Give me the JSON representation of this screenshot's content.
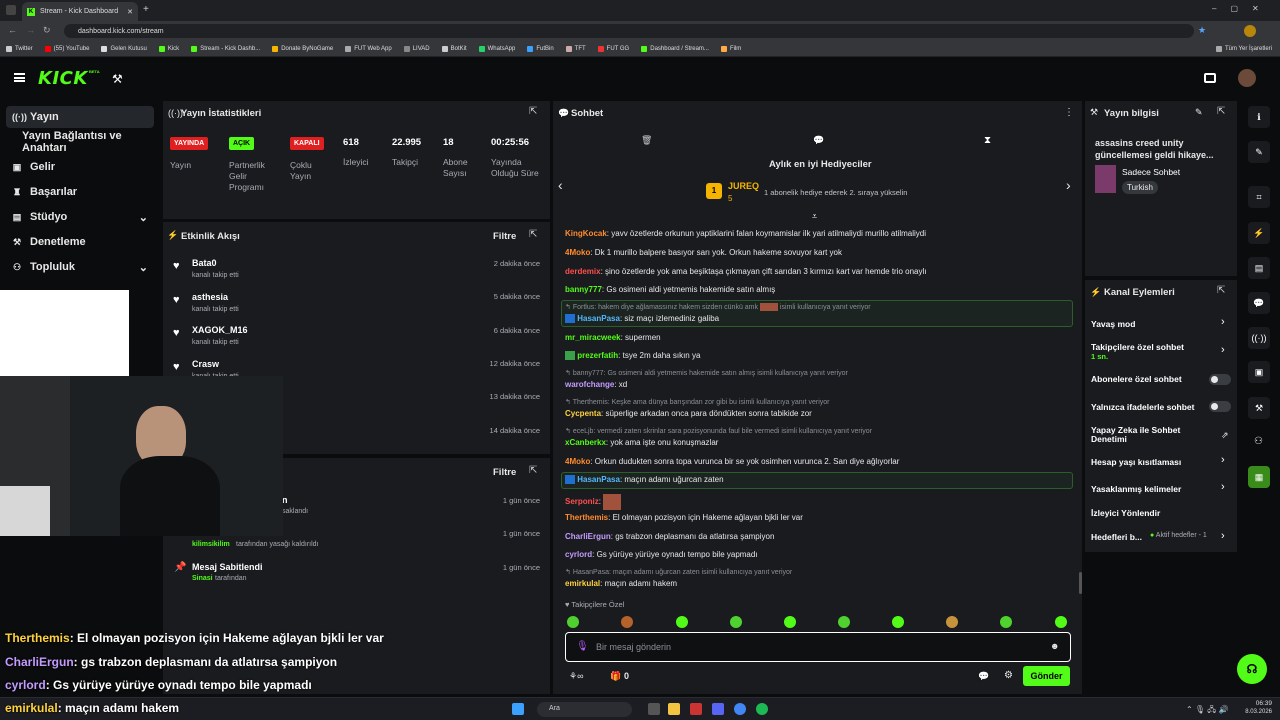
{
  "browser": {
    "tab_title": "Stream - Kick Dashboard",
    "url": "dashboard.kick.com/stream",
    "bookmarks": [
      "Twitter",
      "(55) YouTube",
      "Gelen Kutusu",
      "Kick",
      "Stream - Kick Dashb...",
      "Donate ByNoGame",
      "FUT Web App",
      "LIVAD",
      "BotKit",
      "WhatsApp",
      "FutBin",
      "TFT",
      "FUT GG",
      "Dashboard / Stream...",
      "Film"
    ],
    "bookmarks_all": "Tüm Yer İşaretleri"
  },
  "header": {
    "logo": "KICK",
    "beta": "BETA"
  },
  "nav": {
    "items": [
      "Yayın",
      "Yayın Bağlantısı ve Anahtarı",
      "Gelir",
      "Başarılar",
      "Stüdyo",
      "Denetleme",
      "Topluluk"
    ]
  },
  "stats": {
    "title": "Yayın İstatistikleri",
    "badges": [
      {
        "badge": "YAYINDA",
        "label": "Yayın",
        "color": "#e02020"
      },
      {
        "badge": "AÇIK",
        "label": "Partnerlik Gelir Programı",
        "color": "#53fc18"
      },
      {
        "badge": "KAPALI",
        "label": "Çoklu Yayın",
        "color": "#e02020"
      }
    ],
    "values": [
      {
        "value": "618",
        "label": "İzleyici"
      },
      {
        "value": "22.995",
        "label": "Takipçi"
      },
      {
        "value": "18",
        "label": "Abone Sayısı"
      },
      {
        "value": "00:25:56",
        "label": "Yayında Olduğu Süre"
      }
    ]
  },
  "activity": {
    "title": "Etkinlik Akışı",
    "filter": "Filtre",
    "items": [
      {
        "name": "Bata0",
        "sub": "kanalı takip etti",
        "time": "2 dakika önce"
      },
      {
        "name": "asthesia",
        "sub": "kanalı takip etti",
        "time": "5 dakika önce"
      },
      {
        "name": "XAGOK_M16",
        "sub": "kanalı takip etti",
        "time": "6 dakika önce"
      },
      {
        "name": "Crasw",
        "sub": "kanalı takip etti",
        "time": "12 dakika önce"
      },
      {
        "name": "",
        "sub": "",
        "time": "13 dakika önce"
      },
      {
        "name": "",
        "sub": "",
        "time": "14 dakika önce"
      }
    ]
  },
  "modlog": {
    "filter": "Filtre",
    "items": [
      {
        "name": "n",
        "sub": "saklandı",
        "time": "1 gün önce"
      },
      {
        "name": "",
        "sub_user": "kilimsikilim",
        "sub": "tarafından yasağı kaldırıldı",
        "time": "1 gün önce"
      },
      {
        "name": "Mesaj Sabitlendi",
        "sub_user": "Sinasi",
        "sub": "tarafından",
        "time": "1 gün önce"
      }
    ]
  },
  "chat": {
    "title": "Sohbet",
    "top_gifters": "Aylık en iyi Hediyeciler",
    "gifter_name": "JUREQ",
    "gifter_count": "5",
    "gifter_note": "1 abonelik hediye ederek 2. sıraya yükselin",
    "messages": [
      {
        "user": "KingKocak",
        "color": "#ff8c2e",
        "text": "yavv özetlerde orkunun yaptiklarini falan koymamislar ilk yari atilmaliydi murillo atilmaliydi"
      },
      {
        "user": "4Moko",
        "color": "#ff8c2e",
        "text": "Dk 1 murillo balpere basıyor sarı yok. Orkun hakeme sovuyor kart yok"
      },
      {
        "user": "derdemix",
        "color": "#ff4f4f",
        "text": "şino özetlerde yok ama beşiktaşa çıkmayan çift sarıdan 3 kırmızı kart var hemde trio onaylı"
      },
      {
        "user": "banny777",
        "color": "#53fc18",
        "text": "Gs osimeni aldi yetmemis hakemide satın almış"
      },
      {
        "reply": "Fortlus: hakem diye ağlamassınız hakem sizden cünkü amk",
        "reply_tail": "isimli kullanıcıya yanıt veriyor",
        "user": "HasanPasa",
        "color": "#55b8ff",
        "text": "siz maçı izlemediniz galiba"
      },
      {
        "user": "mr_miracweek",
        "color": "#53fc18",
        "text": "supermen"
      },
      {
        "user": "prezerfatih",
        "color": "#53fc18",
        "text": "tsye 2m daha sıkın ya"
      },
      {
        "reply": "banny777: Gs osimeni aldi yetmemis hakemide satın almış isimli kullanıcıya yanıt veriyor",
        "user": "warofchange",
        "color": "#c49cff",
        "text": "xd"
      },
      {
        "reply": "Therthemis: Keşke ama dünya barışından zor gibi bu isimli kullanıcıya yanıt veriyor",
        "user": "Cycpenta",
        "color": "#ffd23f",
        "text": "süperlige arkadan onca para döndükten sonra tabikide zor"
      },
      {
        "reply": "eceLjb: vermedi zaten skrinlar sara pozisyonunda faul bile vermedi isimli kullanıcıya yanıt veriyor",
        "user": "xCanberkx",
        "color": "#53fc18",
        "text": "yok ama işte onu konuşmazlar"
      },
      {
        "user": "4Moko",
        "color": "#ff8c2e",
        "text": "Orkun dudukten sonra topa vurunca bir se yok osimhen vurunca 2. San diye ağlıyorlar"
      },
      {
        "user": "HasanPasa",
        "color": "#55b8ff",
        "text": "maçın adamı uğurcan zaten"
      },
      {
        "user": "Serponiz",
        "color": "#ff4f4f",
        "text": ""
      },
      {
        "user": "Therthemis",
        "color": "#ff8c2e",
        "text": "El olmayan pozisyon için Hakeme ağlayan bjkli ler var"
      },
      {
        "user": "CharliErgun",
        "color": "#c49cff",
        "text": "gs trabzon deplasmanı da atlatırsa şampiyon"
      },
      {
        "user": "cyrlord",
        "color": "#c49cff",
        "text": "Gs yürüye yürüye oynadı tempo bile yapmadı"
      },
      {
        "reply": "HasanPasa: maçın adamı uğurcan zaten isimli kullanıcıya yanıt veriyor",
        "user": "emirkulal",
        "color": "#ffd23f",
        "text": "maçın adamı hakem"
      }
    ],
    "followers_only": "Takipçilere Özel",
    "input_placeholder": "Bir mesaj gönderin",
    "send_label": "Gönder",
    "footer_count": "0"
  },
  "stream_info": {
    "title": "Yayın bilgisi",
    "stream_title": "assasins creed unity güncellemesi geldi hikaye...",
    "category": "Sadece Sohbet",
    "language": "Turkish"
  },
  "channel_actions": {
    "title": "Kanal Eylemleri",
    "items": [
      "Yavaş mod",
      "Takipçilere özel sohbet",
      "Abonelere özel sohbet",
      "Yalnızca ifadelerle sohbet",
      "Yapay Zeka ile Sohbet Denetimi",
      "Hesap yaşı kısıtlaması",
      "Yasaklanmış kelimeler",
      "İzleyici Yönlendir",
      "Hedefleri b..."
    ],
    "follower_sub": "1 sn.",
    "goals_status": "Aktif hedefler - 1"
  },
  "overlay": {
    "lines": [
      {
        "user": "Therthemis",
        "color": "#ffd23f",
        "text": ": El olmayan pozisyon için Hakeme ağlayan bjkli ler var"
      },
      {
        "user": "CharliErgun",
        "color": "#c49cff",
        "text": ": gs trabzon deplasmanı da atlatırsa şampiyon"
      },
      {
        "user": "cyrlord",
        "color": "#c49cff",
        "text": ": Gs yürüye yürüye oynadı tempo bile yapmadı"
      },
      {
        "user": "emirkulal",
        "color": "#ffd23f",
        "text": ": maçın adamı hakem"
      }
    ]
  },
  "taskbar": {
    "search": "Ara",
    "time": "06:39",
    "date": "8.03.2026"
  }
}
